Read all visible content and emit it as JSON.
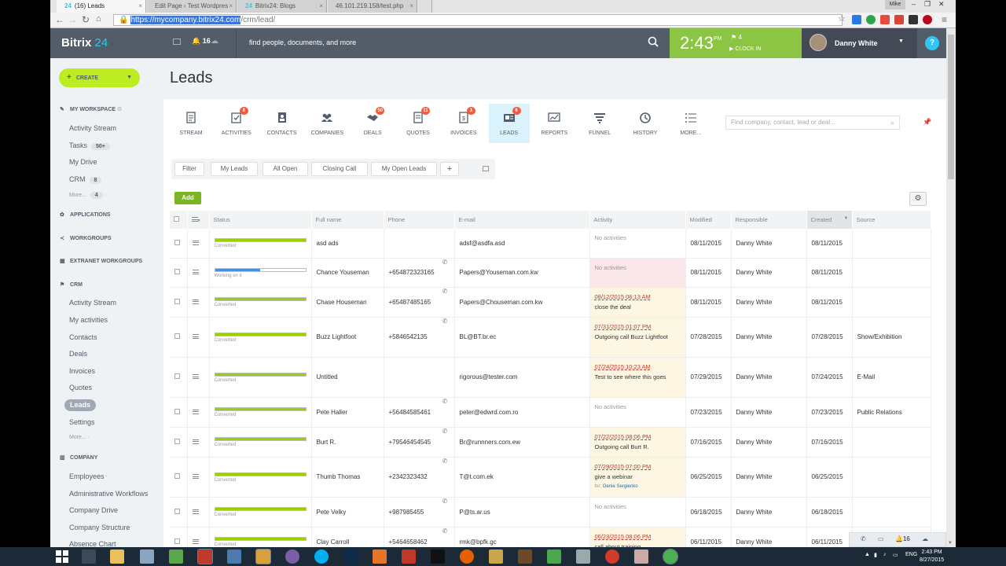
{
  "browser": {
    "tabs": [
      {
        "label": "(16) Leads",
        "icon": "24"
      },
      {
        "label": "Edit Page ‹ Test Wordpres"
      },
      {
        "label": "Bitrix24: Blogs",
        "icon": "24"
      },
      {
        "label": "46.101.219.158/test.php"
      }
    ],
    "user_badge": "Mike",
    "url_host": "https://mycompany.bitrix24.com",
    "url_path": "/crm/lead/"
  },
  "header": {
    "logo_text": "Bitrix",
    "logo_num": "24",
    "notif_count": "16",
    "search_placeholder": "find people, documents, and more",
    "time": "2:43",
    "ampm": "PM",
    "flag_count": "4",
    "clock_in": "CLOCK IN",
    "user_name": "Danny White",
    "help": "?"
  },
  "sidebar": {
    "create_label": "CREATE",
    "my_workspace": "MY WORKSPACE",
    "workspace_items": [
      {
        "label": "Activity Stream"
      },
      {
        "label": "Tasks",
        "badge": "50+"
      },
      {
        "label": "My Drive"
      },
      {
        "label": "CRM",
        "badge": "8"
      },
      {
        "label": "More...",
        "badge": "4"
      }
    ],
    "applications": "APPLICATIONS",
    "workgroups": "WORKGROUPS",
    "extranet": "EXTRANET WORKGROUPS",
    "crm": "CRM",
    "crm_items": [
      "Activity Stream",
      "My activities",
      "Contacts",
      "Deals",
      "Invoices",
      "Quotes",
      "Leads",
      "Settings",
      "More..."
    ],
    "company": "COMPANY",
    "company_items": [
      "Employees",
      "Administrative Workflows",
      "Company Drive",
      "Company Structure",
      "Absence Chart"
    ]
  },
  "main": {
    "title": "Leads",
    "toolbar": [
      {
        "label": "STREAM",
        "icon": "stream-icon"
      },
      {
        "label": "ACTIVITIES",
        "icon": "activities-icon",
        "badge": "8"
      },
      {
        "label": "CONTACTS",
        "icon": "contacts-icon"
      },
      {
        "label": "COMPANIES",
        "icon": "companies-icon"
      },
      {
        "label": "DEALS",
        "icon": "deals-icon",
        "badge": "50"
      },
      {
        "label": "QUOTES",
        "icon": "quotes-icon",
        "badge": "11"
      },
      {
        "label": "INVOICES",
        "icon": "invoices-icon",
        "badge": "3"
      },
      {
        "label": "LEADS",
        "icon": "leads-icon",
        "badge": "6"
      },
      {
        "label": "REPORTS",
        "icon": "reports-icon"
      },
      {
        "label": "FUNNEL",
        "icon": "funnel-icon"
      },
      {
        "label": "HISTORY",
        "icon": "history-icon"
      },
      {
        "label": "MORE...",
        "icon": "more-icon"
      }
    ],
    "search_placeholder": "Find company, contact, lead or deal...",
    "filters": [
      "Filter",
      "My Leads",
      "All Open",
      "Closing Call",
      "My Open Leads",
      "+"
    ],
    "add_label": "Add",
    "columns": [
      "Status",
      "Full name",
      "Phone",
      "E-mail",
      "Activity",
      "Modified",
      "Responsible",
      "Created",
      "Source"
    ],
    "rows": [
      {
        "status": "Converted",
        "progress": 1.0,
        "name": "asd ads",
        "phone": "",
        "email": "adsf@asdfa.asd",
        "act_date": "",
        "act_text": "No activities",
        "act_for": "",
        "act_bg": "none",
        "modified": "08/11/2015",
        "responsible": "Danny White",
        "created": "08/11/2015",
        "source": ""
      },
      {
        "status": "Working on it",
        "progress": 0.5,
        "name": "Chance Youseman",
        "phone": "+654872323165",
        "email": "Papers@Youseman.com.kw",
        "act_date": "",
        "act_text": "No activities",
        "act_for": "",
        "act_bg": "pink",
        "modified": "08/11/2015",
        "responsible": "Danny White",
        "created": "08/11/2015",
        "source": ""
      },
      {
        "status": "Converted",
        "progress": 1.0,
        "name": "Chase Houseman",
        "phone": "+65487485165",
        "email": "Papers@Chouseman.com.kw",
        "act_date": "08/12/2015 06:13 AM",
        "act_text": "close the deal",
        "act_for": "",
        "act_bg": "cream",
        "modified": "08/11/2015",
        "responsible": "Danny White",
        "created": "08/11/2015",
        "source": ""
      },
      {
        "status": "Converted",
        "progress": 1.0,
        "name": "Buzz Lightfoot",
        "phone": "+5846542135",
        "email": "BL@BT.br.ec",
        "act_date": "07/31/2015 01:07 PM",
        "act_text": "Outgoing call Buzz Lightfoot",
        "act_for": "",
        "act_bg": "cream",
        "modified": "07/28/2015",
        "responsible": "Danny White",
        "created": "07/28/2015",
        "source": "Show/Exhibition"
      },
      {
        "status": "Converted",
        "progress": 1.0,
        "name": "Untitled",
        "phone": "",
        "email": "rigorous@tester.com",
        "act_date": "07/24/2015 10:23 AM",
        "act_text": "Test to see where this goes",
        "act_for": "",
        "act_bg": "cream",
        "modified": "07/29/2015",
        "responsible": "Danny White",
        "created": "07/24/2015",
        "source": "E-Mail"
      },
      {
        "status": "Converted",
        "progress": 1.0,
        "name": "Pete Haller",
        "phone": "+56484585461",
        "email": "peter@edwrd.com.ro",
        "act_date": "",
        "act_text": "No activities",
        "act_for": "",
        "act_bg": "none",
        "modified": "07/23/2015",
        "responsible": "Danny White",
        "created": "07/23/2015",
        "source": "Public Relations"
      },
      {
        "status": "Converted",
        "progress": 1.0,
        "name": "Burt R.",
        "phone": "+79546454545",
        "email": "Br@runnners.com.ew",
        "act_date": "07/22/2015 08:06 PM",
        "act_text": "Outgoing call Burt R.",
        "act_for": "",
        "act_bg": "cream",
        "modified": "07/16/2015",
        "responsible": "Danny White",
        "created": "07/16/2015",
        "source": ""
      },
      {
        "status": "Converted",
        "progress": 1.0,
        "name": "Thumb Thomas",
        "phone": "+2342323432",
        "email": "T@t.com.ek",
        "act_date": "07/29/2015 07:00 PM",
        "act_text": "give a webinar",
        "act_for": "Genie Sergienko",
        "act_bg": "cream",
        "modified": "06/25/2015",
        "responsible": "Danny White",
        "created": "06/25/2015",
        "source": ""
      },
      {
        "status": "Converted",
        "progress": 1.0,
        "name": "Pete Velky",
        "phone": "+987985455",
        "email": "P@ts.ar.us",
        "act_date": "",
        "act_text": "No activities",
        "act_for": "",
        "act_bg": "none",
        "modified": "06/18/2015",
        "responsible": "Danny White",
        "created": "06/18/2015",
        "source": ""
      },
      {
        "status": "Converted",
        "progress": 1.0,
        "name": "Clay Carroll",
        "phone": "+5464658462",
        "email": "rmk@bpfk.gc",
        "act_date": "06/23/2015 08:06 PM",
        "act_text": "call about training",
        "act_for": "",
        "act_bg": "cream",
        "modified": "06/11/2015",
        "responsible": "Danny White",
        "created": "06/11/2015",
        "source": ""
      }
    ]
  },
  "bottombar": {
    "count": "16"
  },
  "taskbar": {
    "lang": "ENG",
    "time": "2:43 PM",
    "date": "8/27/2015"
  },
  "colors": {
    "green": "#bbed21",
    "clock": "#8cc543",
    "header": "#535c69",
    "progress_done": "#9dcf00",
    "progress_work": "#4a90d9",
    "badge": "#f15a3d"
  }
}
